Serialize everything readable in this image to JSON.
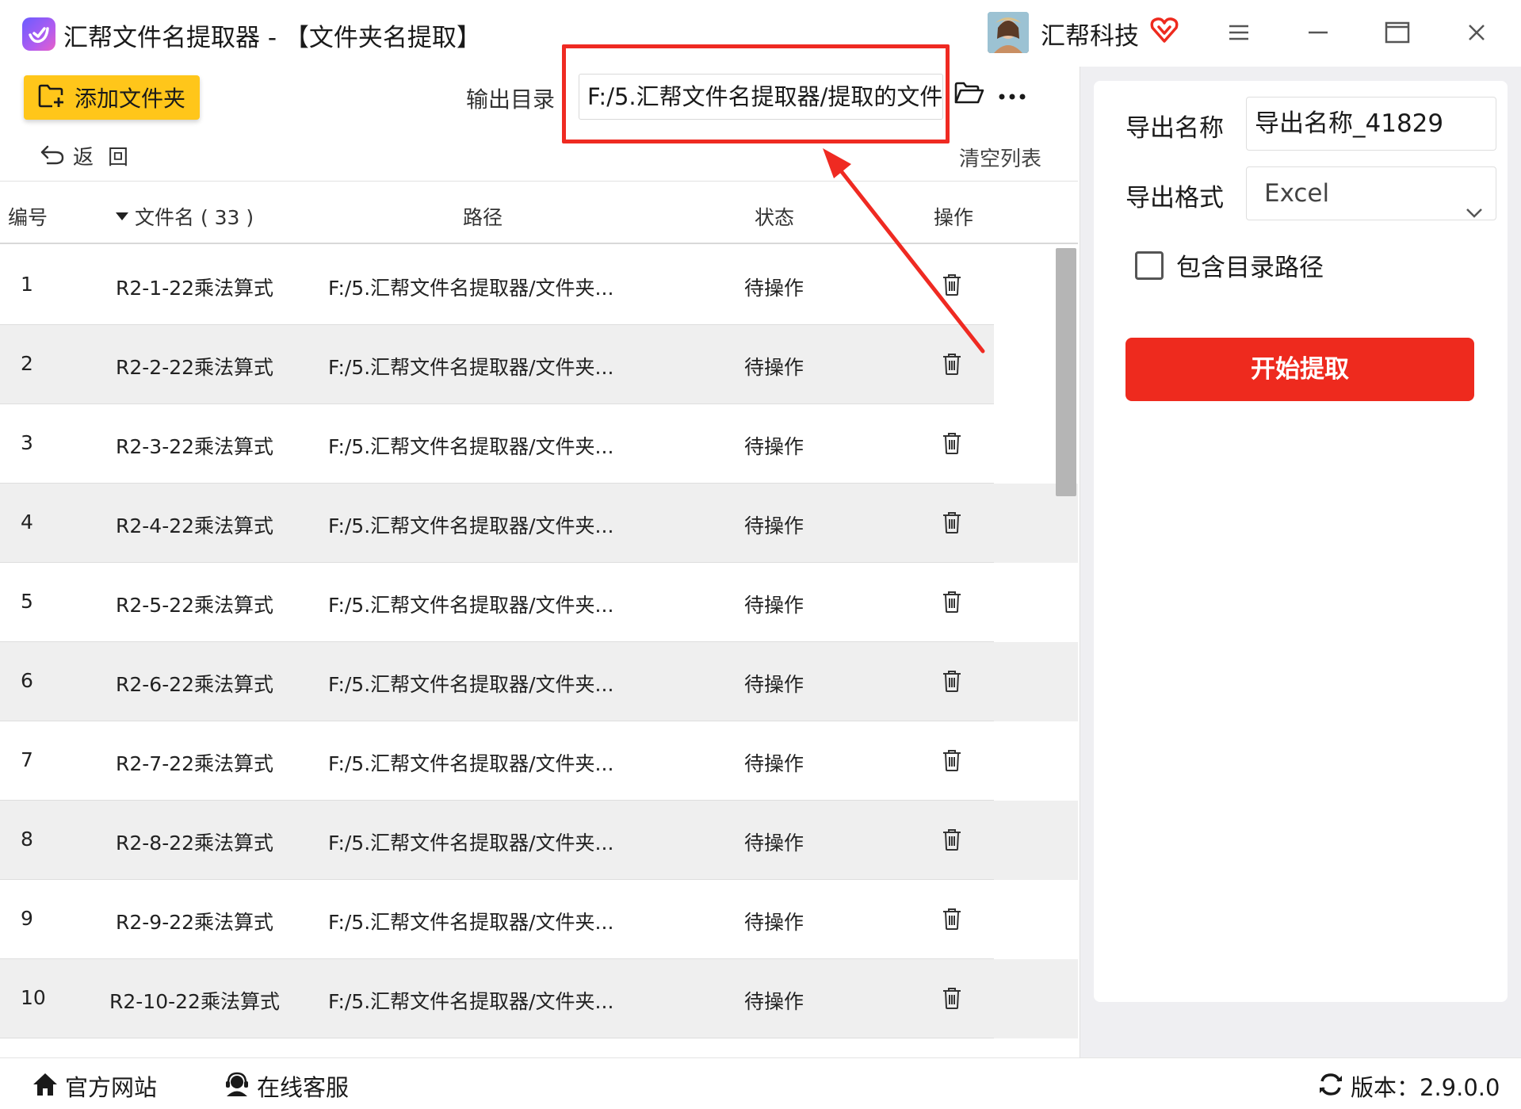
{
  "window": {
    "title": "汇帮文件名提取器 - 【文件夹名提取】",
    "company": "汇帮科技"
  },
  "toolbar": {
    "add_folder_label": "添加文件夹",
    "output_dir_label": "输出目录",
    "output_dir_value": "F:/5.汇帮文件名提取器/提取的文件",
    "back_label": "返回",
    "clear_list_label": "清空列表"
  },
  "table": {
    "headers": {
      "number": "编号",
      "filename": "文件名 ( 33 )",
      "path": "路径",
      "status": "状态",
      "action": "操作"
    },
    "rows": [
      {
        "num": "1",
        "name": "R2-1-22乘法算式",
        "path": "F:/5.汇帮文件名提取器/文件夹...",
        "status": "待操作"
      },
      {
        "num": "2",
        "name": "R2-2-22乘法算式",
        "path": "F:/5.汇帮文件名提取器/文件夹...",
        "status": "待操作"
      },
      {
        "num": "3",
        "name": "R2-3-22乘法算式",
        "path": "F:/5.汇帮文件名提取器/文件夹...",
        "status": "待操作"
      },
      {
        "num": "4",
        "name": "R2-4-22乘法算式",
        "path": "F:/5.汇帮文件名提取器/文件夹...",
        "status": "待操作"
      },
      {
        "num": "5",
        "name": "R2-5-22乘法算式",
        "path": "F:/5.汇帮文件名提取器/文件夹...",
        "status": "待操作"
      },
      {
        "num": "6",
        "name": "R2-6-22乘法算式",
        "path": "F:/5.汇帮文件名提取器/文件夹...",
        "status": "待操作"
      },
      {
        "num": "7",
        "name": "R2-7-22乘法算式",
        "path": "F:/5.汇帮文件名提取器/文件夹...",
        "status": "待操作"
      },
      {
        "num": "8",
        "name": "R2-8-22乘法算式",
        "path": "F:/5.汇帮文件名提取器/文件夹...",
        "status": "待操作"
      },
      {
        "num": "9",
        "name": "R2-9-22乘法算式",
        "path": "F:/5.汇帮文件名提取器/文件夹...",
        "status": "待操作"
      },
      {
        "num": "10",
        "name": "R2-10-22乘法算式",
        "path": "F:/5.汇帮文件名提取器/文件夹...",
        "status": "待操作"
      }
    ]
  },
  "settings": {
    "export_name_label": "导出名称",
    "export_name_value": "导出名称_41829",
    "export_format_label": "导出格式",
    "export_format_value": "Excel",
    "include_path_label": "包含目录路径",
    "include_path_checked": false,
    "start_button_label": "开始提取"
  },
  "footer": {
    "website_label": "官方网站",
    "service_label": "在线客服",
    "version_label": "版本：2.9.0.0"
  },
  "colors": {
    "accent_yellow": "#ffc61a",
    "start_red": "#ee2a1e",
    "highlight_red": "#ef2a22",
    "alt_row": "#efefef"
  },
  "icons": [
    "app-logo-icon",
    "vip-heart-icon",
    "menu-icon",
    "minimize-icon",
    "maximize-icon",
    "close-icon",
    "add-folder-icon",
    "folder-open-icon",
    "more-icon",
    "back-arrow-icon",
    "trash-icon",
    "chevron-down-icon",
    "home-icon",
    "headset-icon",
    "refresh-icon"
  ]
}
